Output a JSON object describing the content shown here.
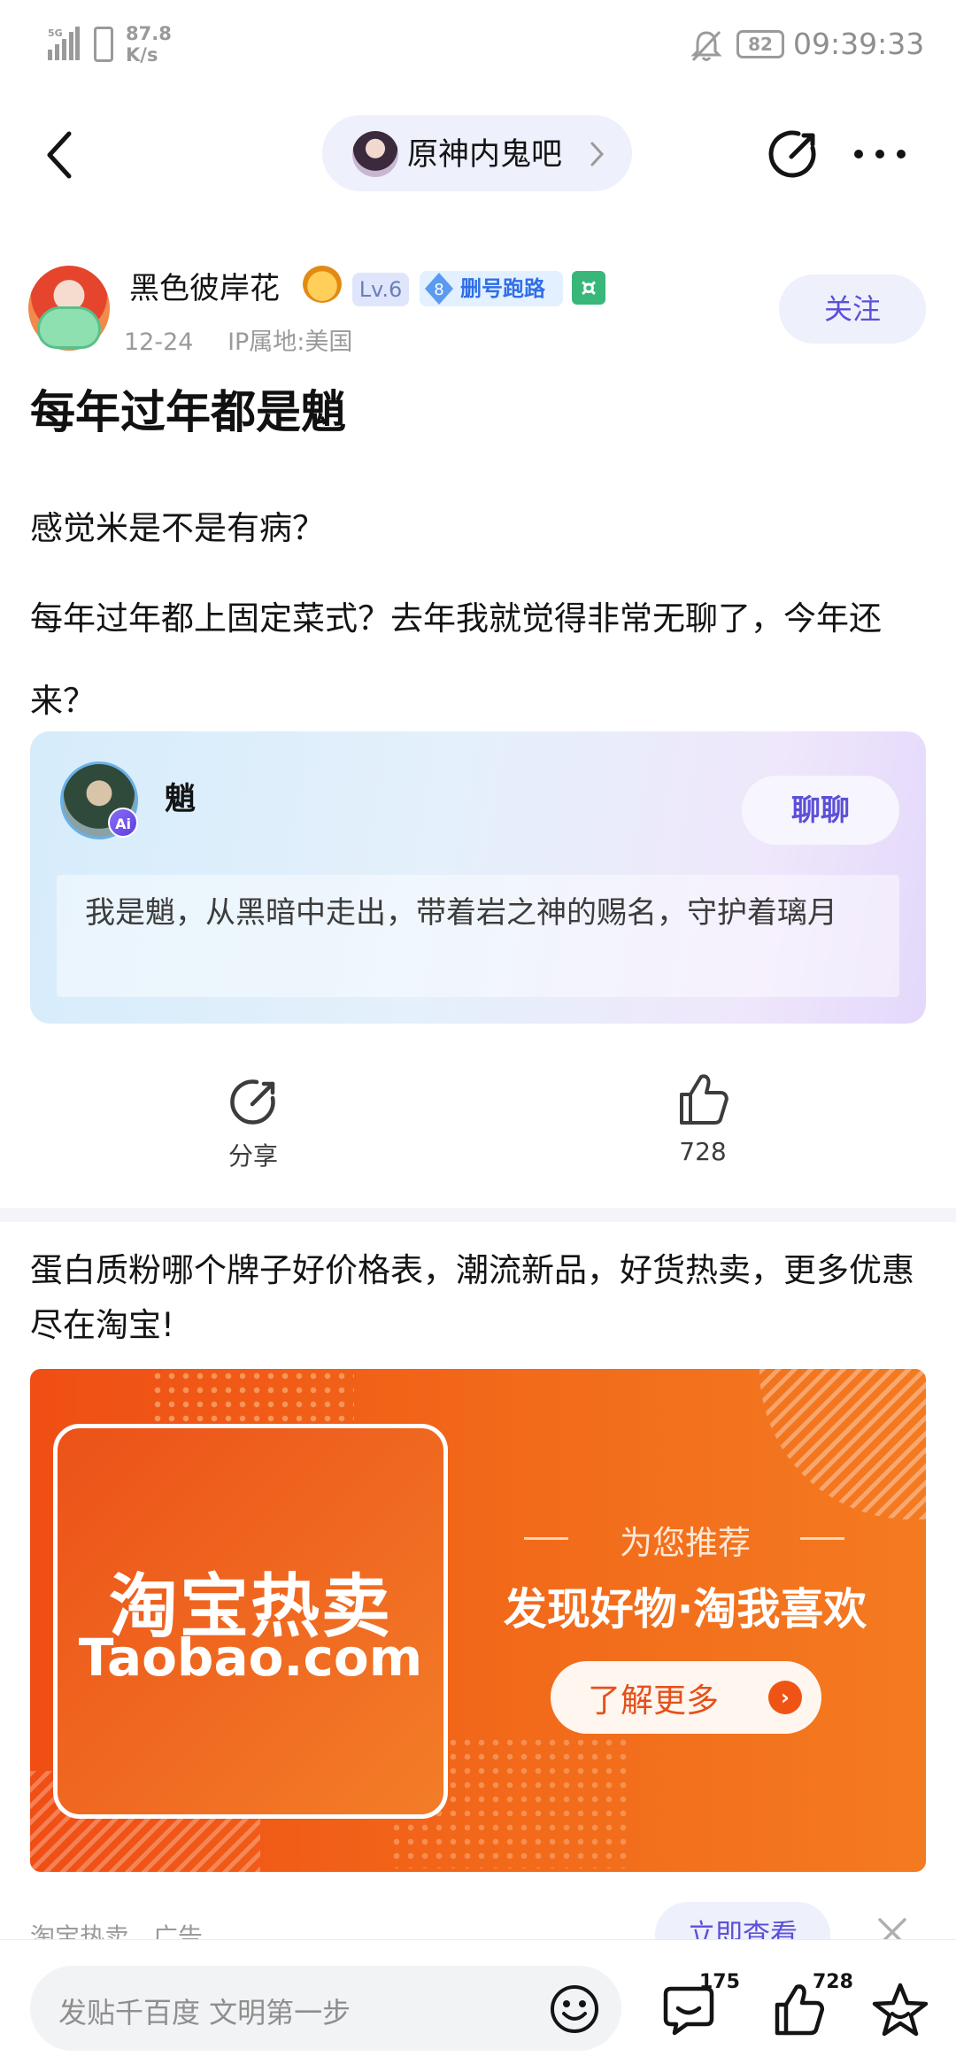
{
  "status_bar": {
    "network": "5G",
    "speed_value": "87.8",
    "speed_unit": "K/s",
    "battery": "82",
    "time": "09:39:33"
  },
  "nav": {
    "forum_name": "原神内鬼吧"
  },
  "post": {
    "author_name": "黑色彼岸花",
    "level": "Lv.6",
    "badge_number": "8",
    "badge_text": "删号跑路",
    "date": "12-24",
    "ip_location": "IP属地:美国",
    "follow_label": "关注",
    "title": "每年过年都是魈",
    "paragraph1": "感觉米是不是有病？",
    "paragraph2": "每年过年都上固定菜式？去年我就觉得非常无聊了，今年还来？"
  },
  "ai_card": {
    "name": "魈",
    "badge": "Ai",
    "chat_label": "聊聊",
    "description": "我是魈，从黑暗中走出，带着岩之神的赐名，守护着璃月"
  },
  "actions": {
    "share_label": "分享",
    "like_count": "728"
  },
  "ad": {
    "title": "蛋白质粉哪个牌子好价格表，潮流新品，好货热卖，更多优惠尽在淘宝!",
    "logo_cn": "淘宝热卖",
    "logo_en": "Taobao.com",
    "recommend": "为您推荐",
    "slogan": "发现好物·淘我喜欢",
    "cta": "了解更多",
    "source": "淘宝热卖",
    "ad_label": "广告",
    "view_label": "立即查看"
  },
  "bottom_bar": {
    "placeholder": "发贴千百度 文明第一步",
    "comment_count": "175",
    "like_count": "728"
  },
  "colors": {
    "accent": "#5b50d8",
    "ad_orange": "#f05414",
    "text": "#141414",
    "muted": "#9a9a9a"
  },
  "icons": [
    "signal-icon",
    "sim-icon",
    "mute-bell-icon",
    "battery-icon",
    "back-icon",
    "chevron-right-icon",
    "share-icon",
    "more-icon",
    "tiger-icon",
    "level-badge",
    "diamond-icon",
    "green-badge-icon",
    "ai-badge-icon",
    "like-icon",
    "arrow-right-icon",
    "close-icon",
    "emoji-icon",
    "comment-icon",
    "star-icon"
  ]
}
